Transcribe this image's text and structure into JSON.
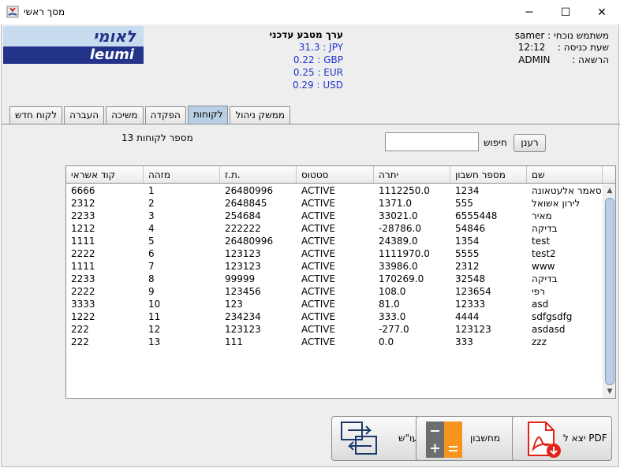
{
  "window": {
    "title": "מסך ראשי",
    "minimize": "─",
    "maximize": "☐",
    "close": "✕"
  },
  "logo": {
    "hebrew": "לאומי",
    "latin": "leumi"
  },
  "rates": {
    "title": "ערך מטבע עדכני",
    "items": [
      "31.3 : JPY",
      "0.22 : GBP",
      "0.25 : EUR",
      "0.29 : USD"
    ]
  },
  "user": {
    "current_user": "samer : משתמש נוכחי",
    "login_time_label": "שעת כניסה :",
    "login_time": "12:12",
    "permission_label": "הרשאה :",
    "permission": "ADMIN"
  },
  "tabs": [
    "לקוח חדש",
    "העברה",
    "משיכה",
    "הפקדה",
    "לקוחות",
    "ממשק ניהול"
  ],
  "active_tab": "לקוחות",
  "customers": {
    "count_label": "13  מספר לקוחות",
    "search_label": "חיפוש",
    "search_value": "",
    "refresh_label": "רענן"
  },
  "table": {
    "columns": [
      "קוד אשראי",
      "מזהה",
      "ת.ז.",
      "סטטוס",
      "יתרה",
      "מספר חשבון",
      "שם"
    ],
    "rows": [
      [
        "6666",
        "1",
        "26480996",
        "ACTIVE",
        "1112250.0",
        "1234",
        "סאמר אלעטאונה"
      ],
      [
        "2312",
        "2",
        "2648845",
        "ACTIVE",
        "1371.0",
        "555",
        "לירון אשואל"
      ],
      [
        "2233",
        "3",
        "254684",
        "ACTIVE",
        "33021.0",
        "6555448",
        "מאיר"
      ],
      [
        "1212",
        "4",
        "222222",
        "ACTIVE",
        "-28786.0",
        "54846",
        "בדיקה"
      ],
      [
        "1111",
        "5",
        "26480996",
        "ACTIVE",
        "24389.0",
        "1354",
        "test"
      ],
      [
        "2222",
        "6",
        "123123",
        "ACTIVE",
        "1111970.0",
        "5555",
        "test2"
      ],
      [
        "1111",
        "7",
        "123123",
        "ACTIVE",
        "33986.0",
        "2312",
        "www"
      ],
      [
        "2233",
        "8",
        "99999",
        "ACTIVE",
        "170269.0",
        "32548",
        "בדיקה"
      ],
      [
        "2222",
        "9",
        "123456",
        "ACTIVE",
        "108.0",
        "123654",
        "רפי"
      ],
      [
        "3333",
        "10",
        "123",
        "ACTIVE",
        "81.0",
        "12333",
        "asd"
      ],
      [
        "1222",
        "11",
        "234234",
        "ACTIVE",
        "333.0",
        "4444",
        "sdfgsdfg"
      ],
      [
        "222",
        "12",
        "123123",
        "ACTIVE",
        "-277.0",
        "123123",
        "asdasd"
      ],
      [
        "222",
        "13",
        "111",
        "ACTIVE",
        "0.0",
        "333",
        "zzz"
      ]
    ]
  },
  "buttons": {
    "exchange": "עו\"ש",
    "calculator": "מחשבון",
    "export_pdf": "יצא ל PDF"
  },
  "icons": {
    "exchange": "exchange-icon",
    "calculator": "calculator-icon",
    "pdf": "pdf-icon",
    "pdf_color": "#e2231a",
    "calc_orange": "#f7941d",
    "calc_gray": "#6d6e71",
    "exchange_blue": "#1b3a6b"
  }
}
